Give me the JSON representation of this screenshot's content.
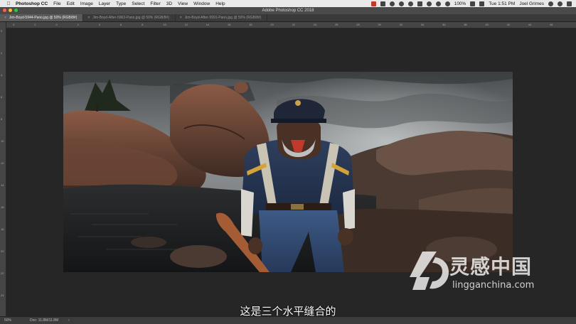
{
  "menubar": {
    "app_name": "Photoshop CC",
    "items": [
      "File",
      "Edit",
      "Image",
      "Layer",
      "Type",
      "Select",
      "Filter",
      "3D",
      "View",
      "Window",
      "Help"
    ],
    "battery": "100%",
    "clock": "Tue 1:51 PM",
    "user": "Joel Grimes"
  },
  "window": {
    "title": "Adobe Photoshop CC 2018"
  },
  "tabs": [
    {
      "label": "Jim-Boyd-5944-Pano.jpg @ 50% (RGB/8#)",
      "active": true
    },
    {
      "label": "Jim-Boyd-After-5963-Pano.jpg @ 50% (RGB/8#)",
      "active": false
    },
    {
      "label": "Jim-Boyd-After-5991-Pano.jpg @ 50% (RGB/8#)",
      "active": false
    }
  ],
  "rulers": {
    "horizontal": [
      "4",
      "2",
      "0",
      "2",
      "4",
      "6",
      "8",
      "10",
      "12",
      "14",
      "16",
      "18",
      "20",
      "22",
      "24",
      "26",
      "28",
      "30",
      "32",
      "34",
      "36",
      "38",
      "40",
      "42",
      "44",
      "46"
    ],
    "vertical": [
      "0",
      "2",
      "4",
      "6",
      "8",
      "10",
      "12",
      "14",
      "16",
      "18",
      "20",
      "22",
      "24"
    ]
  },
  "status": {
    "zoom": "50%",
    "doc": "Doc: 11.8M/11.8M"
  },
  "subtitle": "这是三个水平缝合的",
  "watermark": {
    "name": "灵感中国",
    "url": "lingganchina.com"
  },
  "colors": {
    "menubar": "#e9e9e9",
    "workspace": "#282828",
    "tab_active": "#5a5a5a"
  }
}
